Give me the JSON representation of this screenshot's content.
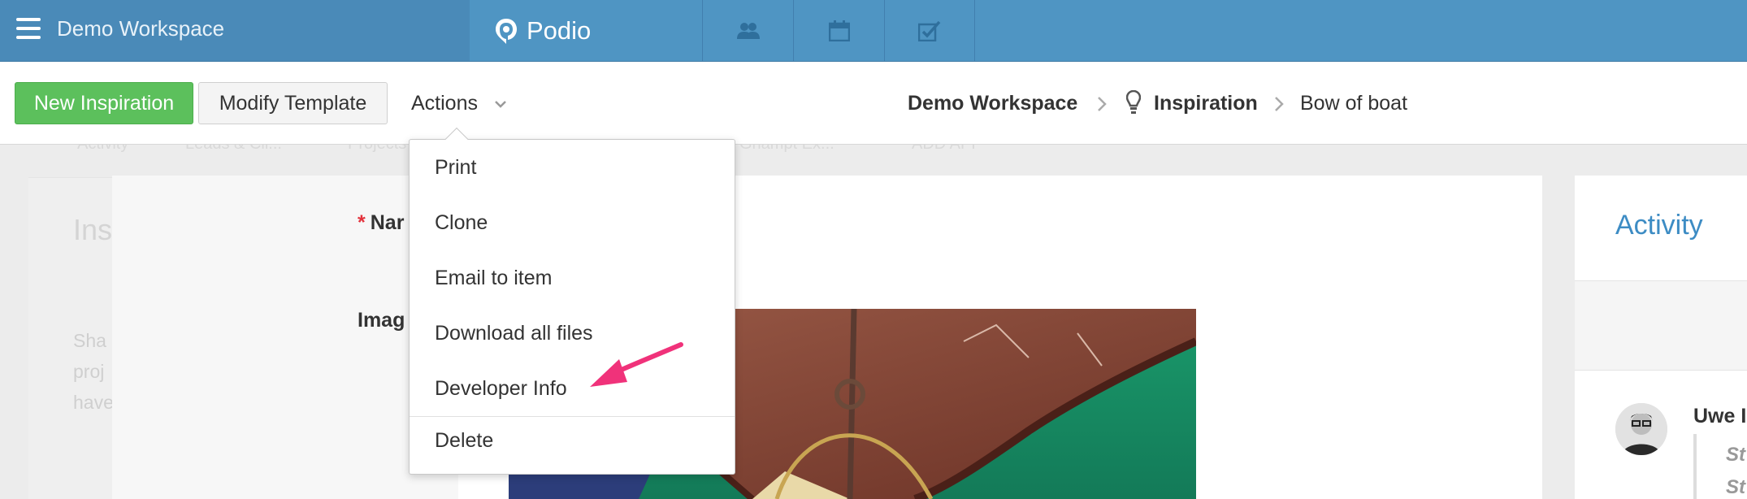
{
  "topnav": {
    "workspace_title": "Demo Workspace",
    "brand": "Podio",
    "icons": [
      "hamburger-icon",
      "podio-logo-icon",
      "contacts-icon",
      "calendar-icon",
      "tasks-icon"
    ]
  },
  "toolbar": {
    "new_button": "New Inspiration",
    "modify_button": "Modify Template",
    "actions_label": "Actions"
  },
  "breadcrumb": {
    "workspace": "Demo Workspace",
    "app": "Inspiration",
    "item": "Bow of boat"
  },
  "app_tabs": [
    "Activity",
    "Leads & Cli...",
    "Projects",
    "Ghampt Ex...",
    "ADD APP"
  ],
  "left_panel": {
    "heading": "Insp",
    "lines": [
      "Sha",
      "proj",
      "have"
    ]
  },
  "item_fields": {
    "name_label": "Nar",
    "image_label": "Imag",
    "required_mark": "*"
  },
  "actions_menu": {
    "items": [
      "Print",
      "Clone",
      "Email to item",
      "Download all files",
      "Developer Info"
    ],
    "danger_item": "Delete"
  },
  "activity": {
    "title": "Activity",
    "user_name": "Uwe I",
    "status_lines": [
      "St",
      "St"
    ]
  },
  "colors": {
    "nav_blue": "#4f95c3",
    "green_button": "#5cc05c",
    "annotation_pink": "#f0327a",
    "link_blue": "#3d8cc4"
  }
}
